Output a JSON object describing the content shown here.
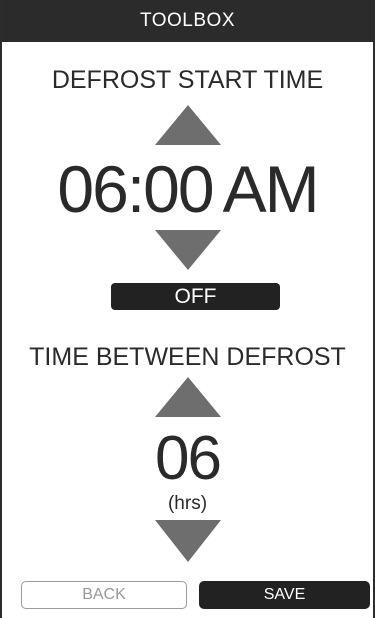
{
  "header": {
    "title": "TOOLBOX"
  },
  "defrost_start": {
    "label": "DEFROST START TIME",
    "time": "06:00",
    "meridiem": "AM",
    "toggle_label": "OFF"
  },
  "time_between": {
    "label": "TIME BETWEEN DEFROST",
    "value": "06",
    "unit": "(hrs)"
  },
  "footer": {
    "back_label": "BACK",
    "save_label": "SAVE"
  },
  "icons": {
    "increase": "triangle-up-icon",
    "decrease": "triangle-down-icon"
  },
  "colors": {
    "title_bar": "#2b2b2b",
    "arrow": "#6e6e6e",
    "toggle": "#222222",
    "save_button": "#222222",
    "back_border": "#9a9a9a"
  }
}
